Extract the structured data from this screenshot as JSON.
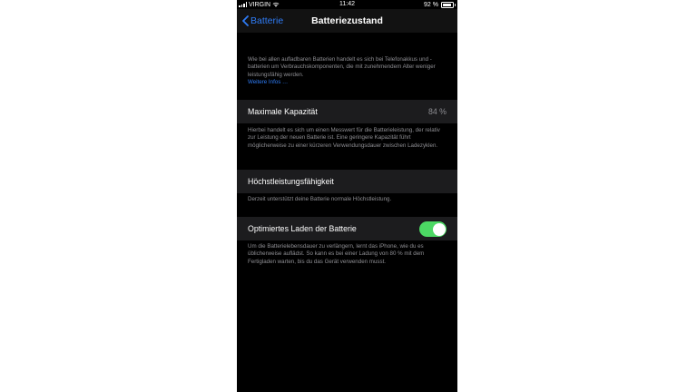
{
  "status_bar": {
    "carrier": "VIRGIN",
    "time": "11:42",
    "battery_percent": "92 %",
    "battery_level": 0.92
  },
  "nav": {
    "back_label": "Batterie",
    "title": "Batteriezustand"
  },
  "intro": {
    "text": "Wie bei allen aufladbaren Batterien handelt es sich bei Telefonakkus und -batterien um Verbrauchskomponenten, die mit zunehmendem Alter weniger leistungsfähig werden.",
    "link": "Weitere Infos …"
  },
  "max_capacity": {
    "label": "Maximale Kapazität",
    "value": "84 %",
    "footer": "Hierbei handelt es sich um einen Messwert für die Batterieleistung, der relativ zur Leistung der neuen Batterie ist. Eine geringere Kapazität führt möglicherweise zu einer kürzeren Verwendungsdauer zwischen Ladezyklen."
  },
  "peak_performance": {
    "label": "Höchstleistungsfähigkeit",
    "footer": "Derzeit unterstützt deine Batterie normale Höchstleistung."
  },
  "optimized_charging": {
    "label": "Optimiertes Laden der Batterie",
    "enabled": true,
    "footer": "Um die Batterielebensdauer zu verlängern, lernt das iPhone, wie du es üblicherweise auflädst. So kann es bei einer Ladung von 80 % mit dem Fertigladen warten, bis du das Gerät verwenden musst."
  },
  "colors": {
    "accent": "#2f7cf6",
    "toggle_on": "#4cd964",
    "background": "#000000",
    "cell": "#1c1c1e"
  }
}
